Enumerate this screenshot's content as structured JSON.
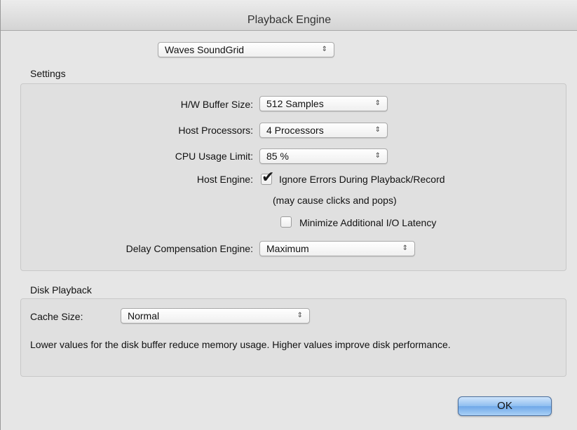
{
  "window": {
    "title": "Playback Engine"
  },
  "engine_select": {
    "value": "Waves SoundGrid",
    "arrows": "⇕"
  },
  "settings": {
    "section_title": "Settings",
    "hw_buffer": {
      "label": "H/W Buffer Size:",
      "value": "512 Samples"
    },
    "host_processors": {
      "label": "Host Processors:",
      "value": "4 Processors"
    },
    "cpu_limit": {
      "label": "CPU Usage Limit:",
      "value": "85 %"
    },
    "host_engine": {
      "label": "Host Engine:",
      "ignore_errors": {
        "label": "Ignore Errors During Playback/Record",
        "checked": true
      },
      "note": "(may cause clicks and pops)",
      "minimize_latency": {
        "label": "Minimize Additional I/O Latency",
        "checked": false
      }
    },
    "delay_comp": {
      "label": "Delay Compensation Engine:",
      "value": "Maximum"
    }
  },
  "disk": {
    "section_title": "Disk Playback",
    "cache": {
      "label": "Cache Size:",
      "value": "Normal"
    },
    "description": "Lower values for the disk buffer reduce memory usage.  Higher values improve disk performance."
  },
  "ok_button": {
    "label": "OK"
  },
  "colors": {
    "ok_button_accent": "#8fbef0",
    "window_bg": "#e6e6e6"
  }
}
